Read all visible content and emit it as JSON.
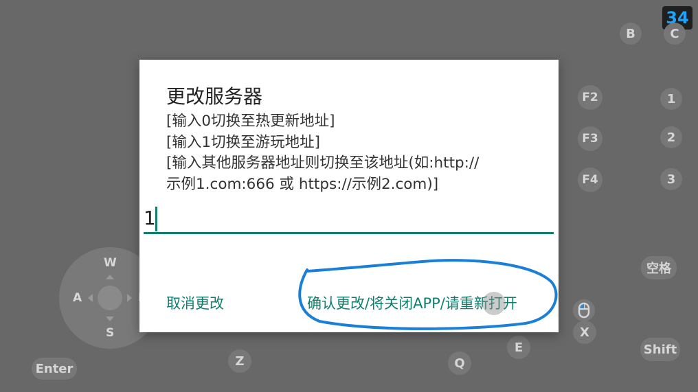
{
  "counter": "34",
  "keys": {
    "b": "B",
    "c": "C",
    "f2": "F2",
    "f3": "F3",
    "f4": "F4",
    "one": "1",
    "two": "2",
    "three": "3",
    "space": "空格",
    "x": "X",
    "shift": "Shift",
    "e": "E",
    "q": "Q",
    "z": "Z",
    "enter": "Enter"
  },
  "dpad": {
    "up": "W",
    "down": "S",
    "left": "A",
    "right": "D"
  },
  "dialog": {
    "title": "更改服务器",
    "lines": [
      "[输入0切换至热更新地址]",
      "[输入1切换至游玩地址]",
      "[输入其他服务器地址则切换至该地址(如:http://",
      "示例1.com:666 或 https://示例2.com)]"
    ],
    "input_value": "1",
    "cancel_label": "取消更改",
    "confirm_label": "确认更改/将关闭APP/请重新打开"
  },
  "colors": {
    "accent": "#0e7f6e",
    "annotation": "#1a7fd6",
    "counter_text": "#1aa3ff",
    "background": "#686868"
  }
}
